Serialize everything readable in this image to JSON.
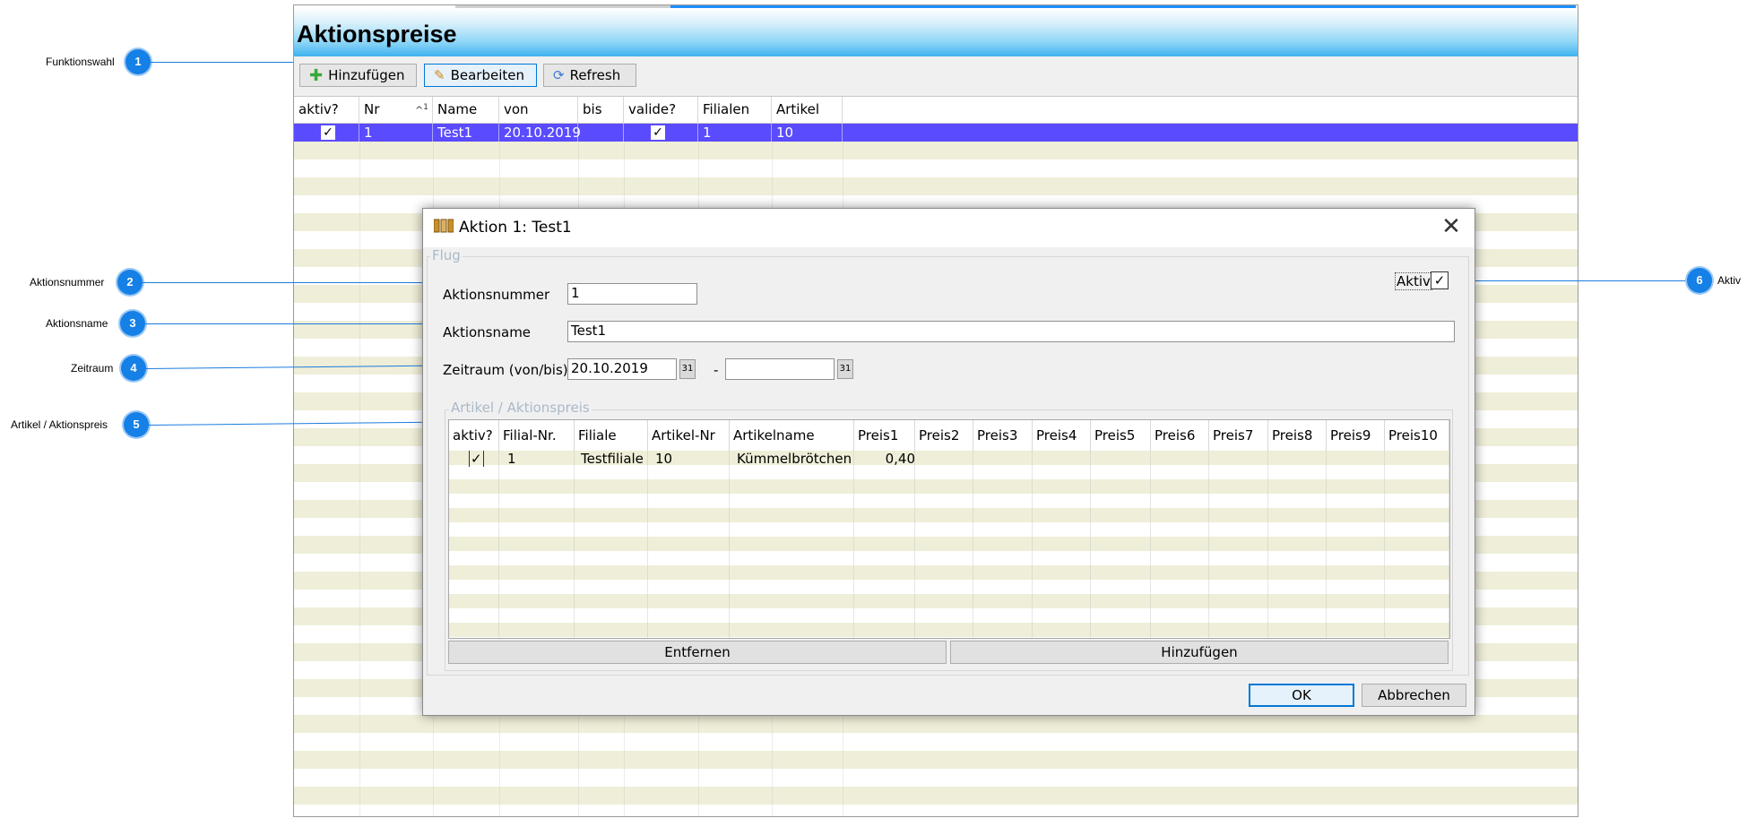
{
  "page_title": "Aktionspreise",
  "toolbar": {
    "add_label": "Hinzufügen",
    "edit_label": "Bearbeiten",
    "refresh_label": "Refresh"
  },
  "main_table": {
    "columns": [
      "aktiv?",
      "Nr",
      "Name",
      "von",
      "bis",
      "valide?",
      "Filialen",
      "Artikel"
    ],
    "sort_indicator": "^",
    "sort_order": "1",
    "rows": [
      {
        "aktiv": "✓",
        "nr": "1",
        "name": "Test1",
        "von": "20.10.2019",
        "bis": "",
        "valide": "✓",
        "filialen": "1",
        "artikel": "10"
      }
    ]
  },
  "callouts": [
    {
      "number": "1",
      "label": "Funktionswahl"
    },
    {
      "number": "2",
      "label": "Aktionsnummer"
    },
    {
      "number": "3",
      "label": "Aktionsname"
    },
    {
      "number": "4",
      "label": "Zeitraum"
    },
    {
      "number": "5",
      "label": "Artikel / Aktionspreis"
    },
    {
      "number": "6",
      "label": "Aktiv"
    }
  ],
  "dialog": {
    "title": "Aktion 1: Test1",
    "group_caption": "Flug",
    "aktiv_label": "Aktiv",
    "aktiv_checked": "✓",
    "fields": {
      "aktionsnummer_label": "Aktionsnummer",
      "aktionsnummer_value": "1",
      "aktionsname_label": "Aktionsname",
      "aktionsname_value": "Test1",
      "zeitraum_label": "Zeitraum (von/bis)",
      "zeitraum_von": "20.10.2019",
      "zeitraum_separator": "-",
      "zeitraum_bis": ""
    },
    "article_group_caption": "Artikel / Aktionspreis",
    "article_table": {
      "columns": [
        "aktiv?",
        "Filial-Nr.",
        "Filiale",
        "Artikel-Nr",
        "Artikelname",
        "Preis1",
        "Preis2",
        "Preis3",
        "Preis4",
        "Preis5",
        "Preis6",
        "Preis7",
        "Preis8",
        "Preis9",
        "Preis10"
      ],
      "rows": [
        {
          "aktiv": "✓",
          "filial_nr": "1",
          "filiale": "Testfiliale",
          "artikel_nr": "10",
          "artikelname": "Kümmelbrötchen",
          "preis1": "0,40"
        }
      ]
    },
    "remove_label": "Entfernen",
    "add_label": "Hinzufügen",
    "ok_label": "OK",
    "cancel_label": "Abbrechen"
  },
  "colors": {
    "selection": "#5a4bff",
    "stripe": "#efeed8",
    "callout": "#1580e6",
    "title_gradient_end": "#3fb1ee"
  }
}
